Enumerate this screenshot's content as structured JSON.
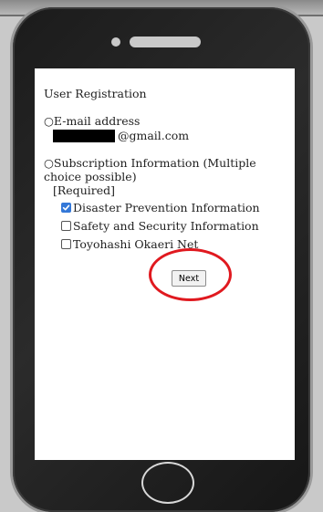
{
  "page": {
    "title": "User Registration",
    "email_label": "○E-mail address",
    "email_domain": "@gmail.com",
    "subscription_label": "○Subscription Information (Multiple choice possible)",
    "required_label": "[Required]"
  },
  "options": [
    {
      "label": "Disaster Prevention Information",
      "checked": true
    },
    {
      "label": "Safety and Security Information",
      "checked": false
    },
    {
      "label": "Toyohashi Okaeri Net",
      "checked": false
    }
  ],
  "buttons": {
    "next_label": "Next"
  },
  "colors": {
    "highlight_ring": "#e0191f",
    "checkbox_checked": "#3478d8",
    "phone_body": "#1b1b1b"
  }
}
